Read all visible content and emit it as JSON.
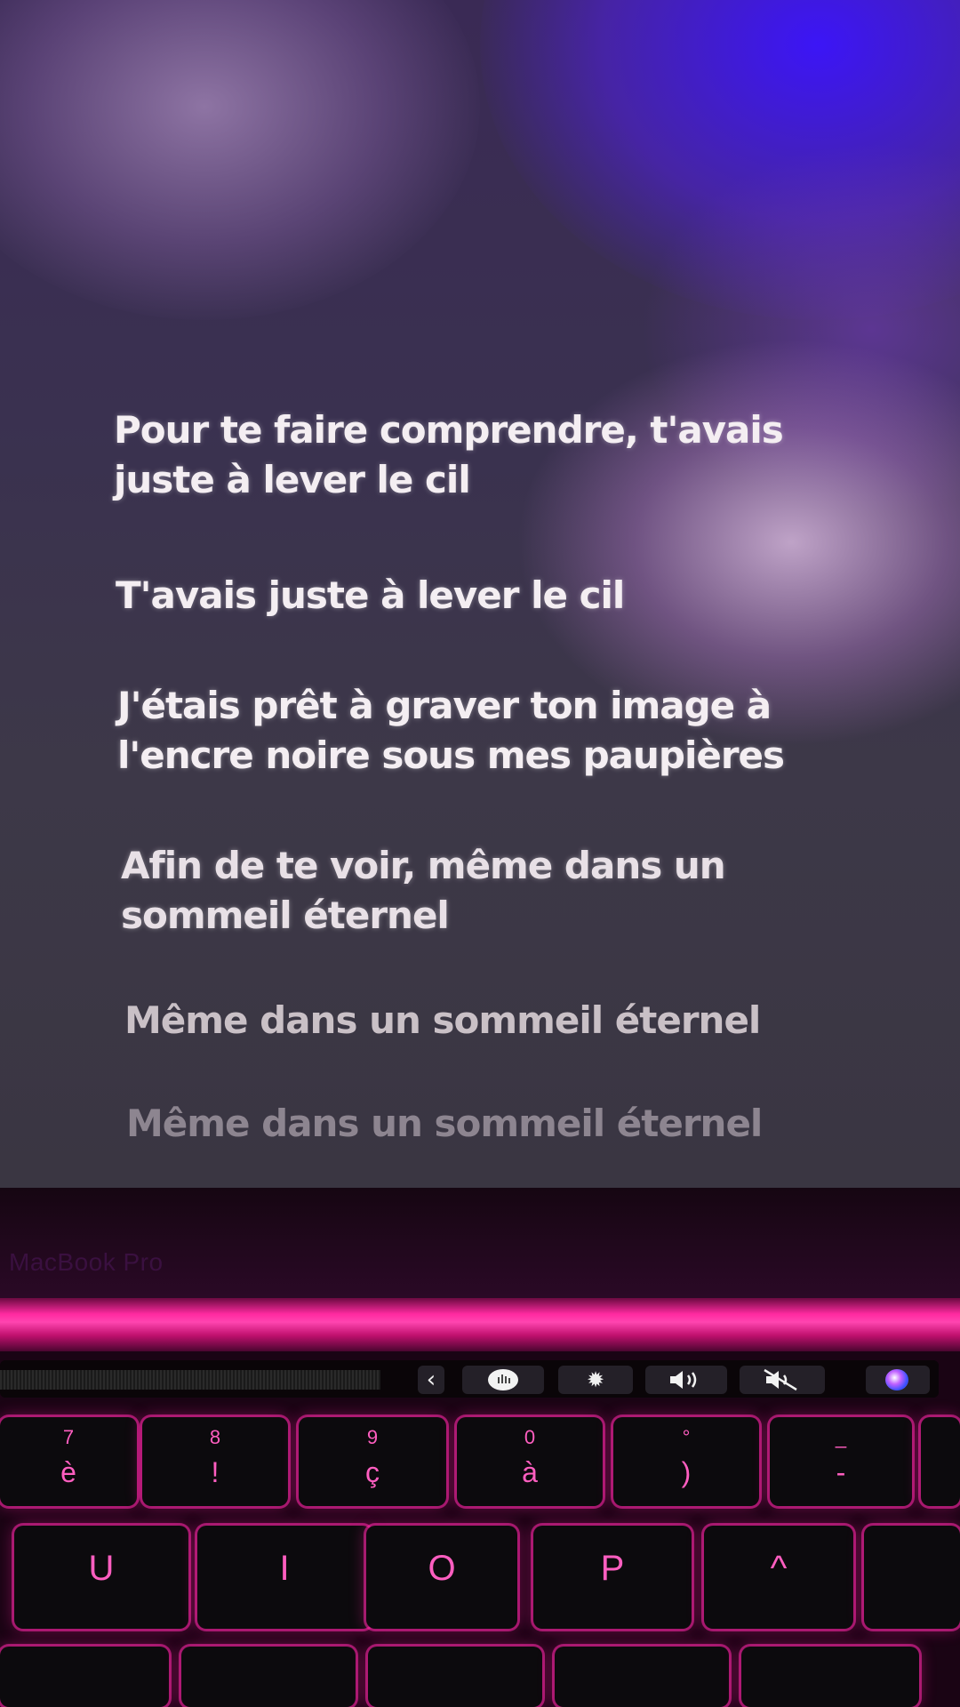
{
  "lyrics": {
    "line1": "Pour te faire comprendre, t'avais",
    "line1b": "juste à lever le cil",
    "line2": "T'avais juste à lever le cil",
    "line3": "J'étais prêt à graver ton image à",
    "line3b": "l'encre noire sous mes paupières",
    "line4": "Afin de te voir, même dans un",
    "line4b": "sommeil éternel",
    "line5": "Même dans un sommeil éternel",
    "line6": "Même dans un sommeil éternel"
  },
  "laptop": {
    "brand": "MacBook Pro"
  },
  "touchbar": {
    "back": "‹",
    "icons": [
      "siri-icon",
      "brightness-icon",
      "volume-icon",
      "mute-icon",
      "siri-orb-icon"
    ]
  },
  "keys": {
    "row1": [
      {
        "top": "7",
        "bottom": "è"
      },
      {
        "top": "8",
        "bottom": "!"
      },
      {
        "top": "9",
        "bottom": "ç"
      },
      {
        "top": "0",
        "bottom": "à"
      },
      {
        "top": "°",
        "bottom": ")"
      },
      {
        "top": "_",
        "bottom": "-"
      }
    ],
    "row2": [
      "U",
      "I",
      "O",
      "P",
      "^"
    ]
  }
}
